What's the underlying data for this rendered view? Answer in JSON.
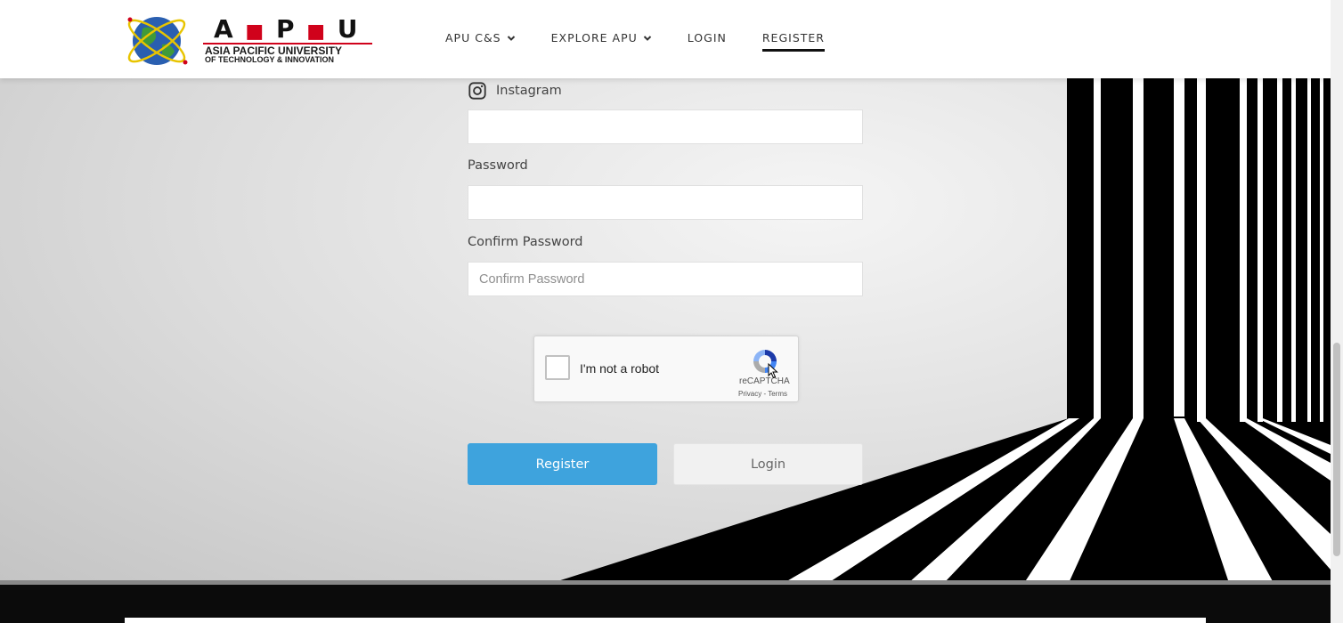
{
  "header": {
    "logo": {
      "letters": [
        "A",
        "P",
        "U"
      ],
      "line1": "ASIA PACIFIC UNIVERSITY",
      "line2": "OF TECHNOLOGY & INNOVATION",
      "accent_color": "#d0021b"
    },
    "nav": [
      {
        "label": "APU C&S",
        "has_dropdown": true,
        "icon": "chevron-down-icon"
      },
      {
        "label": "EXPLORE APU",
        "has_dropdown": true,
        "icon": "chevron-down-icon"
      },
      {
        "label": "LOGIN",
        "has_dropdown": false
      },
      {
        "label": "REGISTER",
        "has_dropdown": false,
        "active": true
      }
    ]
  },
  "form": {
    "instagram": {
      "label": "Instagram",
      "icon": "instagram-icon",
      "value": ""
    },
    "password": {
      "label": "Password",
      "value": ""
    },
    "confirm_password": {
      "label": "Confirm Password",
      "placeholder": "Confirm Password",
      "value": ""
    }
  },
  "recaptcha": {
    "checkbox_label": "I'm not a robot",
    "brand": "reCAPTCHA",
    "privacy": "Privacy",
    "separator": "-",
    "terms": "Terms",
    "checked": false
  },
  "buttons": {
    "register": "Register",
    "login": "Login"
  },
  "colors": {
    "register_button": "#3ea3dd",
    "login_button": "#f1f1f1",
    "footer": "#0b0b0b",
    "nav_active_underline": "#111111"
  }
}
